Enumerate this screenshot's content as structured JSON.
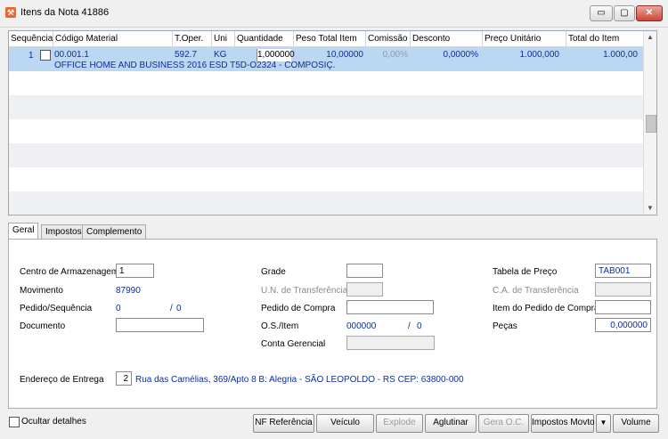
{
  "window": {
    "title": "Itens da Nota 41886",
    "minimize_glyph": "▭",
    "maximize_glyph": "▢",
    "close_glyph": "✕"
  },
  "grid": {
    "columns": [
      "Sequência",
      "Código Material",
      "T.Oper.",
      "Uni",
      "Quantidade",
      "Peso Total Item",
      "Comissão",
      "Desconto",
      "Preço Unitário",
      "Total do Item"
    ],
    "row": {
      "seq": "1",
      "codigo": "00.001.1",
      "toper": "592.7",
      "uni": "KG",
      "quantidade": "1,000000",
      "peso": "10,00000",
      "comissao": "0,00%",
      "desconto": "0,0000%",
      "preco": "1.000,000",
      "total": "1.000,00",
      "descricao": "OFFICE HOME AND BUSINESS 2016 ESD T5D-O2324 - COMPOSIÇ."
    }
  },
  "tabs": [
    {
      "label": "Geral"
    },
    {
      "label": "Impostos"
    },
    {
      "label": "Complemento"
    }
  ],
  "form": {
    "centro_label": "Centro de Armazenagem",
    "centro_value": "1",
    "movimento_label": "Movimento",
    "movimento_value": "87990",
    "pedido_seq_label": "Pedido/Sequência",
    "pedido_value": "0",
    "pedido_sep": "/",
    "pedido_seq_value": "0",
    "documento_label": "Documento",
    "documento_value": "",
    "grade_label": "Grade",
    "grade_value": "",
    "un_transf_label": "U.N. de Transferência",
    "pedido_compra_label": "Pedido de Compra",
    "pedido_compra_value": "",
    "os_item_label": "O.S./Item",
    "os_value": "000000",
    "os_sep": "/",
    "os_item_value": "0",
    "conta_label": "Conta Gerencial",
    "tabela_label": "Tabela de Preço",
    "tabela_value": "TAB001",
    "ca_transf_label": "C.A. de Transferência",
    "item_pedido_label": "Item do Pedido de Compra",
    "item_pedido_value": "",
    "pecas_label": "Peças",
    "pecas_value": "0,000000",
    "endereco_label": "Endereço de Entrega",
    "endereco_num": "2",
    "endereco_text": "Rua das Camélias, 369/Apto 8 B: Alegria - SÃO LEOPOLDO - RS CEP: 63800-000"
  },
  "footer": {
    "ocultar_label": "Ocultar detalhes",
    "buttons": {
      "nf_ref": "NF Referência",
      "veiculo": "Veículo",
      "explode": "Explode",
      "aglutinar": "Aglutinar",
      "gera_oc": "Gera O.C.",
      "impostos_movto": "Impostos Movto",
      "more": "▼",
      "volume": "Volume"
    }
  },
  "colors": {
    "selected_row": "#bcd7f1",
    "value_text": "#0b2ea0",
    "app_icon": "#e8662a"
  }
}
